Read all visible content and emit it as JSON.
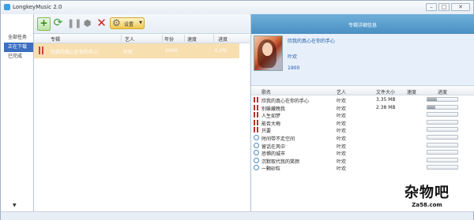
{
  "window": {
    "title": "LongkeyMusic 2.0",
    "controls": [
      "–",
      "□",
      "✕"
    ]
  },
  "sidebar": {
    "items": [
      {
        "label": "全部任务",
        "active": false
      },
      {
        "label": "正在下载",
        "active": true
      },
      {
        "label": "已完成",
        "active": false
      }
    ],
    "scroll_arrow": "▼"
  },
  "toolbar": {
    "add": "+",
    "refresh": "⟳",
    "pause": "❚❚",
    "trash": "⬢",
    "delete": "✕",
    "settings_label": "设置",
    "settings_dropdown": "▼"
  },
  "task_list": {
    "columns": [
      "专辑",
      "艺人",
      "年份",
      "速度",
      "进度"
    ],
    "rows": [
      {
        "album": "欣我的真心在你的手心",
        "artist": "叶欢",
        "year": "1900",
        "speed": "",
        "progress": "0.0%"
      }
    ]
  },
  "detail": {
    "header": "专辑详细信息",
    "album_title": "欣我的真心在你的手心",
    "artist": "叶欢",
    "year": "1900",
    "columns": [
      "歌名",
      "艺人",
      "文件大小",
      "速度",
      "进度"
    ],
    "tracks": [
      {
        "status": "paused",
        "name": "欣我的真心在你的手心",
        "artist": "叶欢",
        "size": "3.35 MB",
        "speed": "",
        "progress": 0.32
      },
      {
        "status": "paused",
        "name": "别躲藏晚我",
        "artist": "叶欢",
        "size": "2.38 MB",
        "speed": "",
        "progress": 0.26
      },
      {
        "status": "paused",
        "name": "人生如梦",
        "artist": "叶欢",
        "size": "",
        "speed": "",
        "progress": 0
      },
      {
        "status": "paused",
        "name": "能否大梅",
        "artist": "叶欢",
        "size": "",
        "speed": "",
        "progress": 0
      },
      {
        "status": "paused",
        "name": "只要",
        "artist": "叶欢",
        "size": "",
        "speed": "",
        "progress": 0
      },
      {
        "status": "waiting",
        "name": "时间带不走空间",
        "artist": "叶欢",
        "size": "",
        "speed": "",
        "progress": 0
      },
      {
        "status": "waiting",
        "name": "留话在风中",
        "artist": "叶欢",
        "size": "",
        "speed": "",
        "progress": 0
      },
      {
        "status": "waiting",
        "name": "恐惧的城市",
        "artist": "叶欢",
        "size": "",
        "speed": "",
        "progress": 0
      },
      {
        "status": "waiting",
        "name": "沉默取代我的笑颜",
        "artist": "叶欢",
        "size": "",
        "speed": "",
        "progress": 0
      },
      {
        "status": "waiting",
        "name": "一颗砂粒",
        "artist": "叶欢",
        "size": "",
        "speed": "",
        "progress": 0
      }
    ]
  },
  "watermark": {
    "text": "杂物吧",
    "url": "Za58.com"
  },
  "colors": {
    "accent": "#3b6fbf",
    "selected_row": "#f8dfb0",
    "header_blue": "#5b9ccd",
    "pause_red": "#c0302b"
  }
}
